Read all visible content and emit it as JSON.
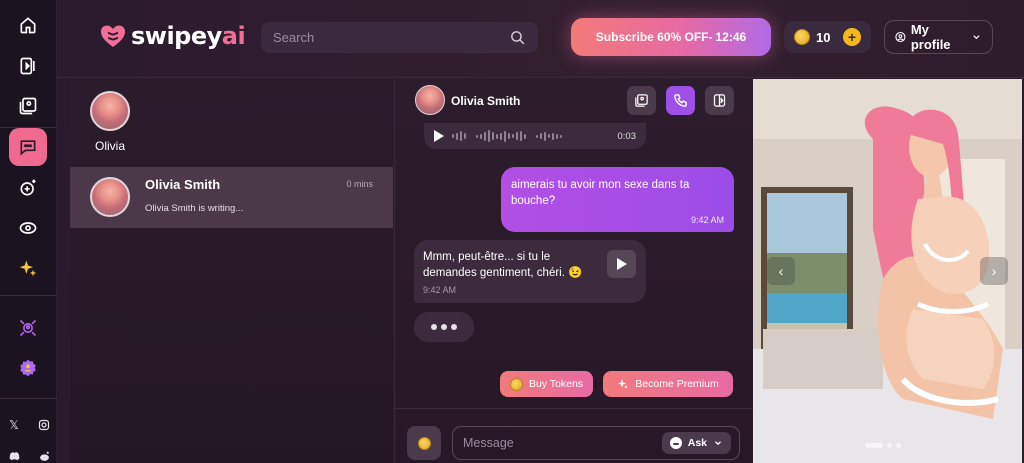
{
  "brand": {
    "name_main": "swipey",
    "name_accent": "ai",
    "accent_color": "#f36e97"
  },
  "sidebar": {
    "items": [
      {
        "icon": "home-icon"
      },
      {
        "icon": "video-icon"
      },
      {
        "icon": "gallery-icon"
      },
      {
        "icon": "chat-icon",
        "active": true
      },
      {
        "icon": "create-icon"
      },
      {
        "icon": "discover-icon"
      },
      {
        "icon": "sparkles-icon"
      },
      {
        "icon": "affiliate-icon"
      },
      {
        "icon": "premium-badge-icon"
      }
    ],
    "social": [
      "x-icon",
      "instagram-icon",
      "discord-icon",
      "reddit-icon"
    ]
  },
  "header": {
    "search_placeholder": "Search",
    "subscribe_label": "Subscribe 60% OFF-",
    "subscribe_timer": "12:46",
    "token_count": "10",
    "profile_label": "My profile"
  },
  "chat_list": {
    "favorites": [
      {
        "name": "Olivia"
      }
    ],
    "conversations": [
      {
        "name": "Olivia Smith",
        "time": "0 mins",
        "preview": "Olivia Smith is writing..."
      }
    ]
  },
  "chat": {
    "title": "Olivia Smith",
    "header_buttons": [
      "gallery-icon",
      "phone-icon",
      "panel-toggle-icon"
    ],
    "messages": [
      {
        "type": "voice",
        "duration": "0:03"
      },
      {
        "type": "user",
        "text": "aimerais tu avoir mon sexe dans ta bouche?",
        "time": "9:42 AM"
      },
      {
        "type": "bot",
        "text": "Mmm, peut-être... si tu le demandes gentiment, chéri. 😉",
        "time": "9:42 AM"
      },
      {
        "type": "typing"
      }
    ],
    "cta": {
      "buy_tokens": "Buy Tokens",
      "become_premium": "Become Premium"
    },
    "composer": {
      "placeholder": "Message",
      "ask_label": "Ask"
    }
  },
  "photo_panel": {
    "slide_count": 3,
    "active_slide": 1
  }
}
